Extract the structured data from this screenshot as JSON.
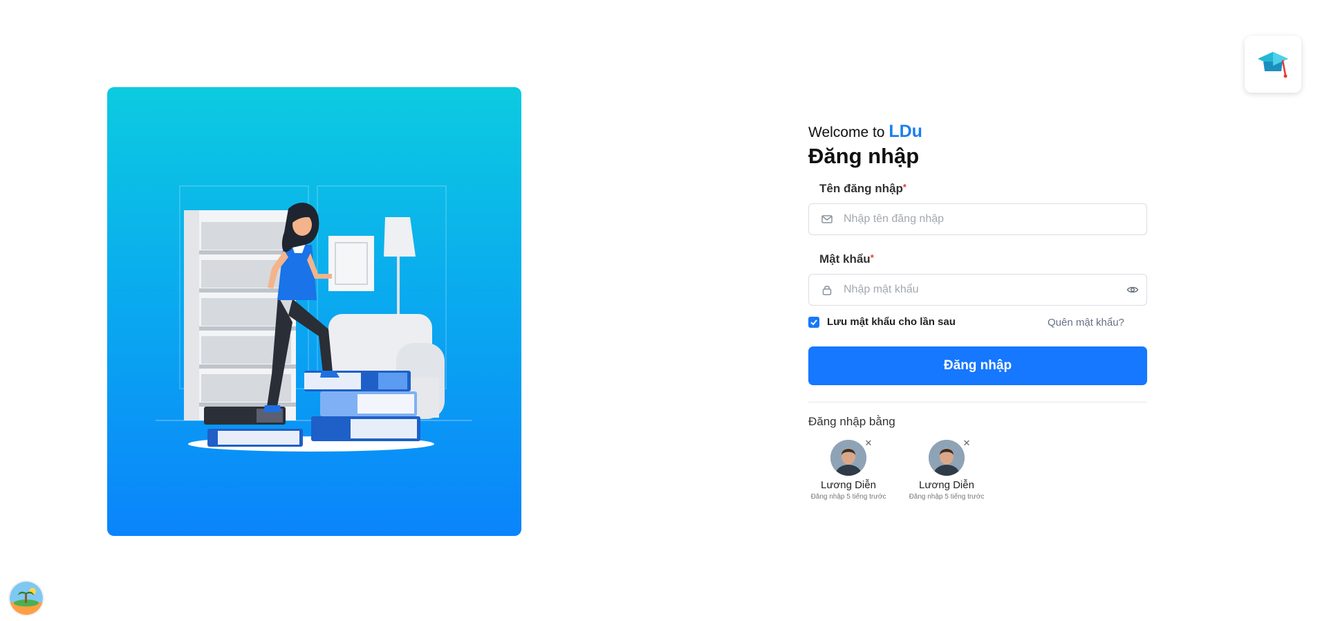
{
  "welcome": {
    "prefix": "Welcome to",
    "brand": "LDu"
  },
  "title": "Đăng nhập",
  "username": {
    "label": "Tên đăng nhập",
    "required_mark": "*",
    "placeholder": "Nhập tên đăng nhập",
    "value": "",
    "icon": "mail-icon"
  },
  "password": {
    "label": "Mật khẩu",
    "required_mark": "*",
    "placeholder": "Nhập mật khẩu",
    "value": "",
    "icon": "lock-icon",
    "toggle_icon": "eye-icon"
  },
  "remember": {
    "label": "Lưu mật khẩu cho lần sau",
    "checked": true
  },
  "forgot_link": "Quên mật khẩu?",
  "submit_label": "Đăng nhập",
  "alt_login_label": "Đăng nhập bằng",
  "saved_accounts": [
    {
      "name": "Lương Diễn",
      "last_login": "Đăng nhập 5 tiếng trước"
    },
    {
      "name": "Lương Diễn",
      "last_login": "Đăng nhập 5 tiếng trước"
    }
  ],
  "colors": {
    "primary": "#1677ff",
    "brand": "#1a7ef0",
    "required": "#e53935",
    "illustration_top": "#0ccbe0",
    "illustration_bottom": "#0a84fb"
  }
}
